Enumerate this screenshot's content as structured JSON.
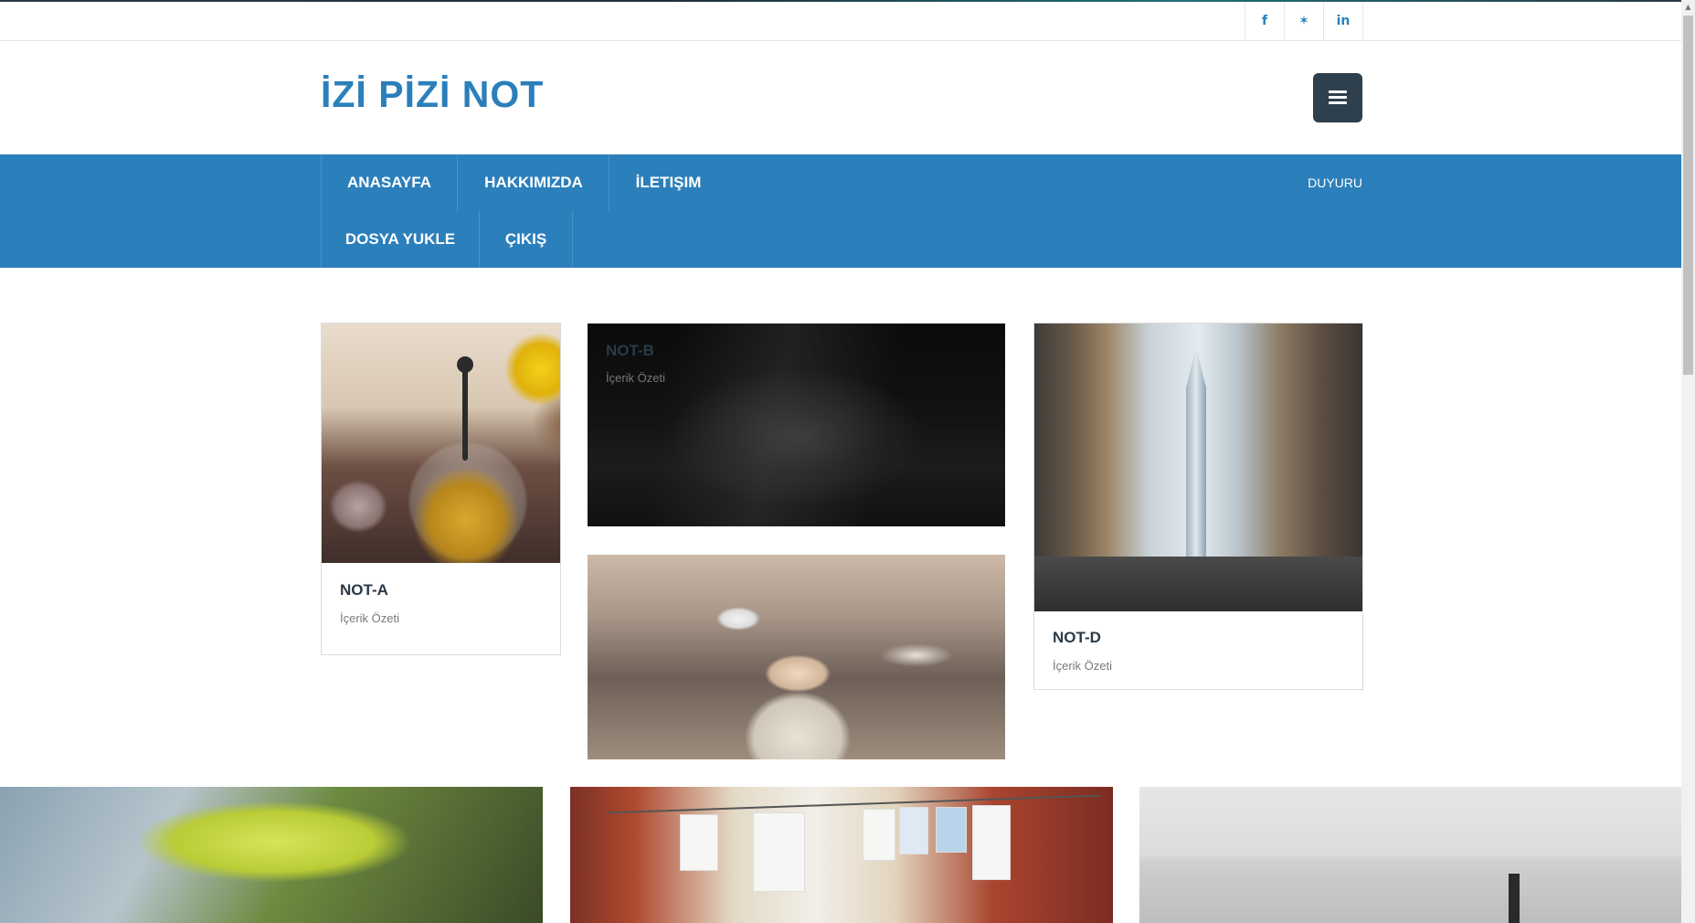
{
  "social": [
    {
      "name": "facebook",
      "glyph": "f"
    },
    {
      "name": "twitter",
      "glyph": "✶"
    },
    {
      "name": "linkedin",
      "glyph": "in"
    }
  ],
  "header": {
    "logo": "İZİ PİZİ NOT",
    "menu_icon": "hamburger-icon"
  },
  "nav": {
    "items": [
      "ANASAYFA",
      "HAKKIMIZDA",
      "İLETIŞIM",
      "DOSYA YUKLE",
      "ÇIKIŞ"
    ],
    "side_label": "DUYURU"
  },
  "cards": [
    {
      "title": "NOT-A",
      "summary": "İçerik Özeti"
    },
    {
      "title": "NOT-B",
      "summary": "İçerik Özeti"
    },
    {
      "title": "NOT-D",
      "summary": "İçerik Özeti"
    }
  ],
  "colors": {
    "brand": "#2b7fbb",
    "dark_button": "#2e3f4d",
    "accent_red": "#e03a3a"
  }
}
